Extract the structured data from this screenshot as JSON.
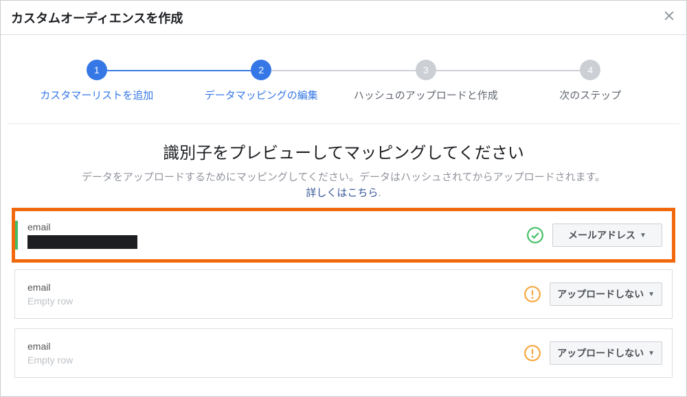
{
  "modal": {
    "title": "カスタムオーディエンスを作成"
  },
  "stepper": {
    "steps": [
      {
        "num": "1",
        "label": "カスタマーリストを追加"
      },
      {
        "num": "2",
        "label": "データマッピングの編集"
      },
      {
        "num": "3",
        "label": "ハッシュのアップロードと作成"
      },
      {
        "num": "4",
        "label": "次のステップ"
      }
    ]
  },
  "content": {
    "heading": "識別子をプレビューしてマッピングしてください",
    "subtext": "データをアップロードするためにマッピングしてください。データはハッシュされてからアップロードされます。",
    "learn_more": "詳しくはこちら",
    "dot": "."
  },
  "rows": [
    {
      "label": "email",
      "value_kind": "redacted",
      "value": "",
      "status": "ok",
      "dropdown": "メールアドレス"
    },
    {
      "label": "email",
      "value_kind": "empty",
      "value": "Empty row",
      "status": "warn",
      "dropdown": "アップロードしない"
    },
    {
      "label": "email",
      "value_kind": "empty",
      "value": "Empty row",
      "status": "warn",
      "dropdown": "アップロードしない"
    }
  ]
}
